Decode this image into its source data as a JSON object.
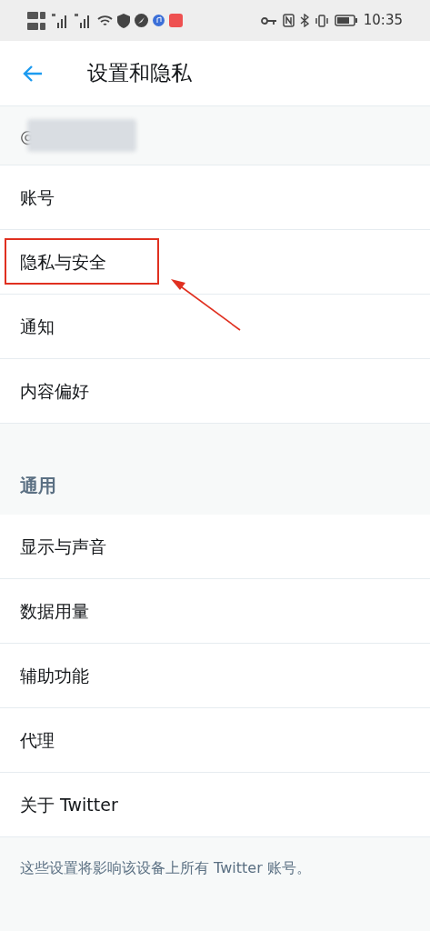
{
  "status_bar": {
    "time": "10:35"
  },
  "header": {
    "title": "设置和隐私"
  },
  "account": {
    "handle_prefix": "@"
  },
  "sections": [
    {
      "items": [
        {
          "label": "账号",
          "highlighted": false
        },
        {
          "label": "隐私与安全",
          "highlighted": true
        },
        {
          "label": "通知",
          "highlighted": false
        },
        {
          "label": "内容偏好",
          "highlighted": false
        }
      ]
    },
    {
      "heading": "通用",
      "items": [
        {
          "label": "显示与声音",
          "highlighted": false
        },
        {
          "label": "数据用量",
          "highlighted": false
        },
        {
          "label": "辅助功能",
          "highlighted": false
        },
        {
          "label": "代理",
          "highlighted": false
        },
        {
          "label": "关于 Twitter",
          "highlighted": false
        }
      ]
    }
  ],
  "footer": "这些设置将影响该设备上所有 Twitter 账号。"
}
